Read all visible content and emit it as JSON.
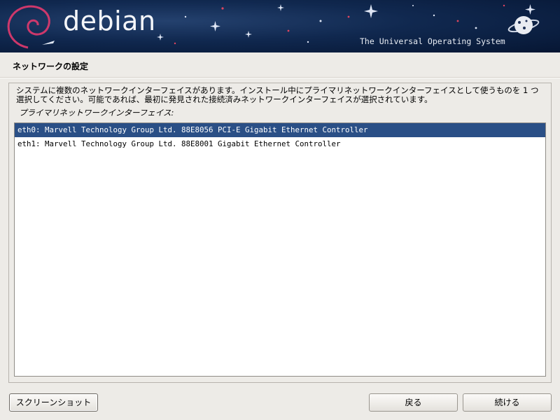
{
  "banner": {
    "brand": "debian",
    "tagline": "The Universal Operating System"
  },
  "page": {
    "title": "ネットワークの設定"
  },
  "main": {
    "description": "システムに複数のネットワークインターフェイスがあります。インストール中にプライマリネットワークインターフェイスとして使うものを 1 つ選択してください。可能であれば、最初に発見された接続済みネットワークインターフェイスが選択されています。",
    "list_label": "プライマリネットワークインターフェイス:",
    "interfaces": [
      {
        "label": "eth0: Marvell Technology Group Ltd. 88E8056 PCI-E Gigabit Ethernet Controller",
        "selected": true
      },
      {
        "label": "eth1: Marvell Technology Group Ltd. 88E8001 Gigabit Ethernet Controller",
        "selected": false
      }
    ]
  },
  "buttons": {
    "screenshot": "スクリーンショット",
    "back": "戻る",
    "continue": "続ける"
  },
  "colors": {
    "selection": "#2a4f86",
    "banner": "#10284f"
  }
}
